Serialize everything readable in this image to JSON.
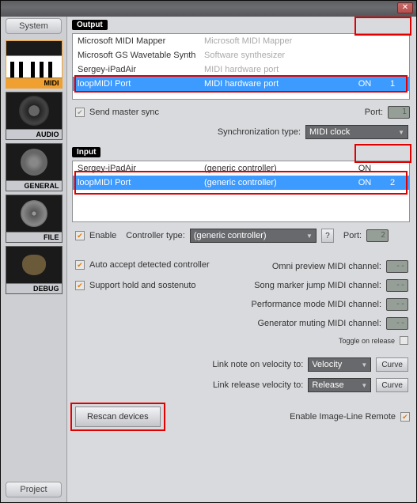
{
  "titlebar": {
    "close_icon": "✕"
  },
  "sidebar": {
    "top_tab": "System",
    "bottom_tab": "Project",
    "items": [
      {
        "label": "MIDI",
        "selected": true
      },
      {
        "label": "AUDIO",
        "selected": false
      },
      {
        "label": "GENERAL",
        "selected": false
      },
      {
        "label": "FILE",
        "selected": false
      },
      {
        "label": "DEBUG",
        "selected": false
      }
    ]
  },
  "output": {
    "title": "Output",
    "rows": [
      {
        "name": "Microsoft MIDI Mapper",
        "type": "Microsoft MIDI Mapper",
        "on": "",
        "port": "",
        "sel": false,
        "grey_type": true
      },
      {
        "name": "Microsoft GS Wavetable Synth",
        "type": "Software synthesizer",
        "on": "",
        "port": "",
        "sel": false,
        "grey_type": true
      },
      {
        "name": "Sergey-iPadAir",
        "type": "MIDI hardware port",
        "on": "",
        "port": "",
        "sel": false,
        "grey_type": true
      },
      {
        "name": "loopMIDI Port",
        "type": "MIDI hardware port",
        "on": "ON",
        "port": "1",
        "sel": true,
        "grey_type": false
      }
    ],
    "send_master_sync": "Send master sync",
    "port_label": "Port:",
    "port_value": "1",
    "sync_type_label": "Synchronization type:",
    "sync_type_value": "MIDI clock"
  },
  "input": {
    "title": "Input",
    "rows": [
      {
        "name": "Sergey-iPadAir",
        "type": "(generic controller)",
        "on": "ON",
        "port": "",
        "sel": false
      },
      {
        "name": "loopMIDI Port",
        "type": "(generic controller)",
        "on": "ON",
        "port": "2",
        "sel": true
      }
    ],
    "enable_label": "Enable",
    "controller_type_label": "Controller type:",
    "controller_type_value": "(generic controller)",
    "q": "?",
    "port_label": "Port:",
    "port_value": "2"
  },
  "options": {
    "auto_accept": "Auto accept detected controller",
    "support_hold": "Support hold and sostenuto",
    "omni": "Omni preview MIDI channel:",
    "song_marker": "Song marker jump MIDI channel:",
    "perf_mode": "Performance mode MIDI channel:",
    "gen_muting": "Generator muting MIDI channel:",
    "toggle_release": "Toggle on release",
    "lcd_empty": "--",
    "link_note_on": "Link note on velocity to:",
    "link_note_on_value": "Velocity",
    "link_release": "Link release velocity to:",
    "link_release_value": "Release",
    "curve": "Curve"
  },
  "footer": {
    "rescan": "Rescan devices",
    "enable_remote": "Enable Image-Line Remote"
  }
}
